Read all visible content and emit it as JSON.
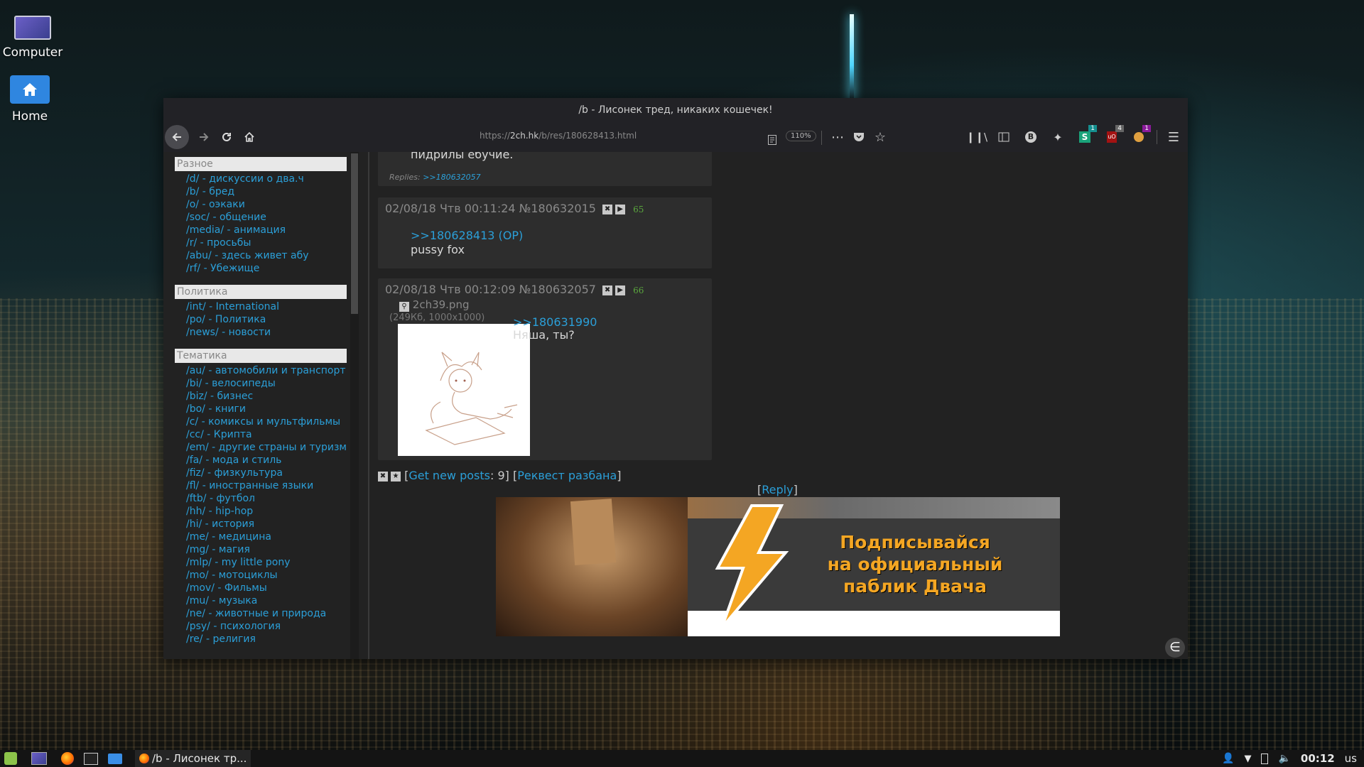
{
  "desktop": {
    "icons": [
      {
        "label": "Computer",
        "icon": "computer-icon"
      },
      {
        "label": "Home",
        "icon": "home-folder-icon"
      }
    ]
  },
  "window": {
    "title": "/b - Лисонек тред, никаких кошечек!"
  },
  "toolbar": {
    "url_prefix": "https://",
    "url_host": "2ch.hk",
    "url_path": "/b/res/180628413.html",
    "zoom": "110%",
    "badges": {
      "ext_s": "1",
      "ext_ublock": "4",
      "ext_other": "1"
    }
  },
  "sidebar": {
    "categories": [
      {
        "title": "Разное",
        "boards": [
          "/d/ - дискуссии о два.ч",
          "/b/ - бред",
          "/o/ - оэкаки",
          "/soc/ - общение",
          "/media/ - анимация",
          "/r/ - просьбы",
          "/abu/ - здесь живет абу",
          "/rf/ - Убежище"
        ]
      },
      {
        "title": "Политика",
        "boards": [
          "/int/ - International",
          "/po/ - Политика",
          "/news/ - новости"
        ]
      },
      {
        "title": "Тематика",
        "boards": [
          "/au/ - автомобили и транспорт",
          "/bi/ - велосипеды",
          "/biz/ - бизнес",
          "/bo/ - книги",
          "/c/ - комиксы и мультфильмы",
          "/cc/ - Крипта",
          "/em/ - другие страны и туризм",
          "/fa/ - мода и стиль",
          "/fiz/ - физкультура",
          "/fl/ - иностранные языки",
          "/ftb/ - футбол",
          "/hh/ - hip-hop",
          "/hi/ - история",
          "/me/ - медицина",
          "/mg/ - магия",
          "/mlp/ - my little pony",
          "/mo/ - мотоциклы",
          "/mov/ - Фильмы",
          "/mu/ - музыка",
          "/ne/ - животные и природа",
          "/psy/ - психология",
          "/re/ - религия"
        ]
      }
    ]
  },
  "thread": {
    "top_post": {
      "text": "пидрилы ебучие.",
      "replies_label": "Replies:",
      "replies_link": ">>180632057"
    },
    "posts": [
      {
        "header": "02/08/18 Чтв 00:11:24 №180632015",
        "number": "65",
        "quote": ">>180628413 (OP)",
        "body": "pussy fox"
      },
      {
        "header": "02/08/18 Чтв 00:12:09 №180632057",
        "number": "66",
        "file_name": "2ch39.png",
        "file_meta": "(249Кб, 1000x1000)",
        "quote": ">>180631990",
        "body": "Няша, ты?"
      }
    ],
    "footer": {
      "get_new": "Get new posts",
      "count": ": 9",
      "request": "Реквест разбана",
      "reply": "Reply"
    }
  },
  "banner": {
    "line1": "Подписывайся",
    "line2": "на официальный",
    "line3": "паблик Двача"
  },
  "taskbar": {
    "task_label": "/b - Лисонек тр...",
    "clock": "00:12",
    "layout": "us"
  }
}
